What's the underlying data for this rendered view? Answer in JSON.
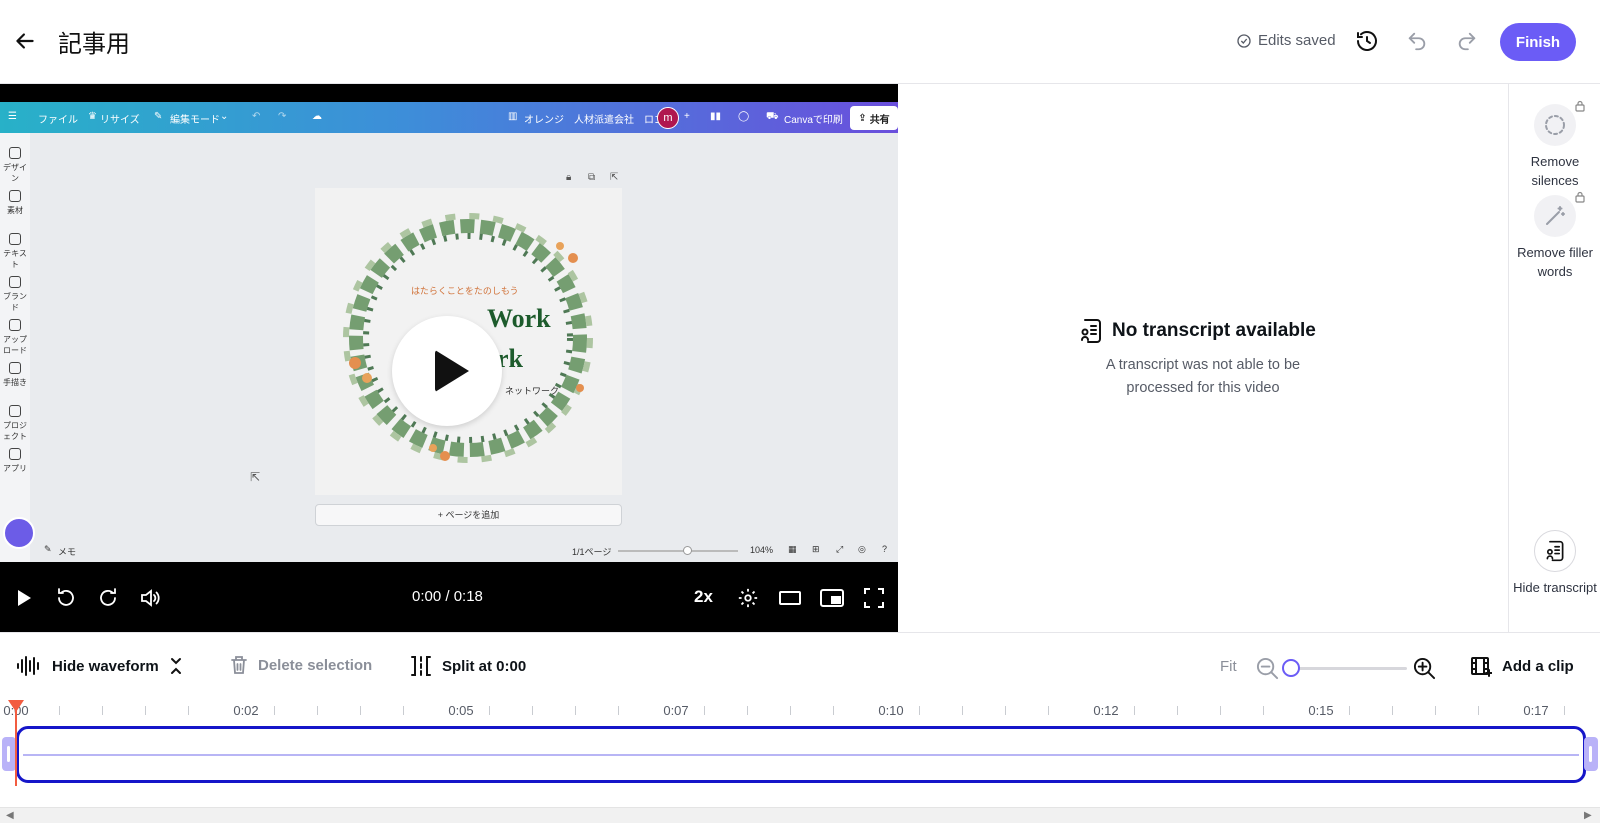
{
  "header": {
    "title": "記事用",
    "edits_status": "Edits saved",
    "finish_label": "Finish"
  },
  "canva_ui": {
    "menu": [
      "ファイル",
      "リサイズ",
      "編集モード"
    ],
    "doc_title": "オレンジ　人材派遣会社　ロゴ",
    "avatar": "m",
    "print_label": "Canvaで印刷",
    "share_label": "共有",
    "sidebar": [
      "デザイン",
      "素材",
      "テキスト",
      "ブランド",
      "アップロード",
      "手描き",
      "プロジェクト",
      "アプリ"
    ],
    "add_page": "+ ページを追加",
    "notes": "メモ",
    "page_indicator": "1/1ページ",
    "zoom": "104%",
    "design_text_top": "はたらくことをたのしもう",
    "design_text_big1": "Work",
    "design_text_big2": "rk",
    "design_text_small": "ネットワーク"
  },
  "video": {
    "time": "0:00 / 0:18",
    "speed": "2x",
    "skip_back": "5",
    "skip_fwd": "5"
  },
  "transcript": {
    "title": "No transcript available",
    "message": "A transcript was not able to be processed for this video"
  },
  "rightbar": {
    "remove_silences": "Remove silences",
    "remove_filler": "Remove filler words",
    "hide_transcript": "Hide transcript"
  },
  "tools": {
    "hide_waveform": "Hide waveform",
    "delete_selection": "Delete selection",
    "split": "Split at 0:00",
    "fit": "Fit",
    "add_clip": "Add a clip"
  },
  "timeline": {
    "labels": [
      "0:00",
      "0:02",
      "0:05",
      "0:07",
      "0:10",
      "0:12",
      "0:15",
      "0:17"
    ]
  },
  "colors": {
    "accent": "#6b5cf6",
    "clip_border": "#1616c9",
    "playhead": "#f25c40"
  }
}
